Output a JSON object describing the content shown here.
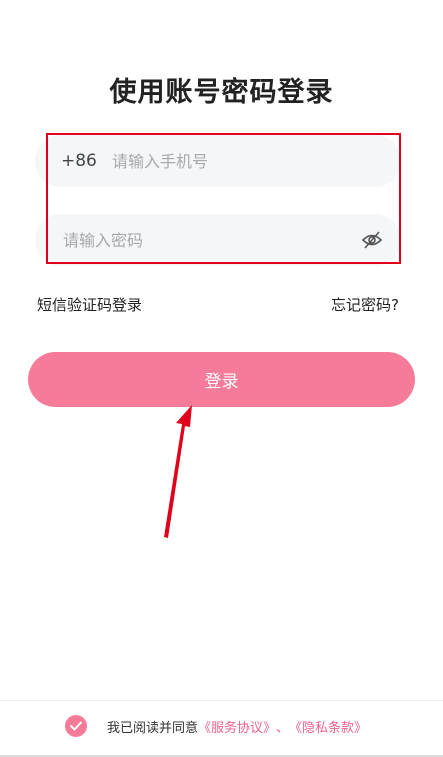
{
  "title": "使用账号密码登录",
  "phone_field": {
    "country_code": "+86",
    "placeholder": "请输入手机号",
    "value": ""
  },
  "password_field": {
    "placeholder": "请输入密码",
    "value": "",
    "toggle_icon": "eye-off-icon"
  },
  "links": {
    "sms_login": "短信验证码登录",
    "forgot_password": "忘记密码?"
  },
  "login_button": "登录",
  "agreement": {
    "checked": true,
    "prefix": "我已阅读并同意",
    "service": "《服务协议》",
    "separator": "、",
    "privacy": "《隐私条款》"
  },
  "colors": {
    "accent": "#f57b98",
    "link_pink": "#f0638a",
    "annotation_red": "#e0001b"
  }
}
